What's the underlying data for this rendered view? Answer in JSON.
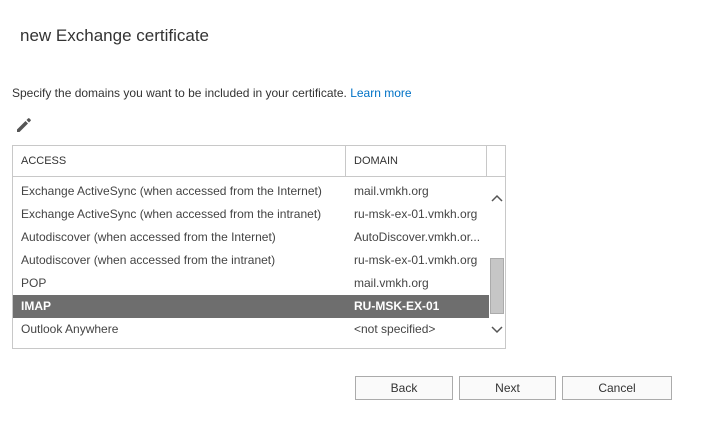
{
  "dialog": {
    "title": "new Exchange certificate",
    "intro_text": "Specify the domains you want to be included in your certificate.",
    "learn_more": "Learn more"
  },
  "icons": {
    "edit": "pencil-icon",
    "scroll_up": "chevron-up-icon",
    "scroll_down": "chevron-down-icon"
  },
  "grid": {
    "headers": {
      "access": "ACCESS",
      "domain": "DOMAIN"
    },
    "rows": [
      {
        "access": "Exchange ActiveSync (when accessed from the Internet)",
        "domain": "mail.vmkh.org"
      },
      {
        "access": "Exchange ActiveSync (when accessed from the intranet)",
        "domain": "ru-msk-ex-01.vmkh.org"
      },
      {
        "access": "Autodiscover (when accessed from the Internet)",
        "domain": "AutoDiscover.vmkh.or..."
      },
      {
        "access": "Autodiscover (when accessed from the intranet)",
        "domain": "ru-msk-ex-01.vmkh.org"
      },
      {
        "access": "POP",
        "domain": "mail.vmkh.org"
      },
      {
        "access": "IMAP",
        "domain": "RU-MSK-EX-01"
      },
      {
        "access": "Outlook Anywhere",
        "domain": "<not specified>"
      }
    ],
    "selected_row": "IMAP"
  },
  "buttons": {
    "back": "Back",
    "next": "Next",
    "cancel": "Cancel"
  },
  "colors": {
    "link": "#0072c6",
    "selected_row_bg": "#6e6e6e",
    "border": "#c8c8c8"
  }
}
